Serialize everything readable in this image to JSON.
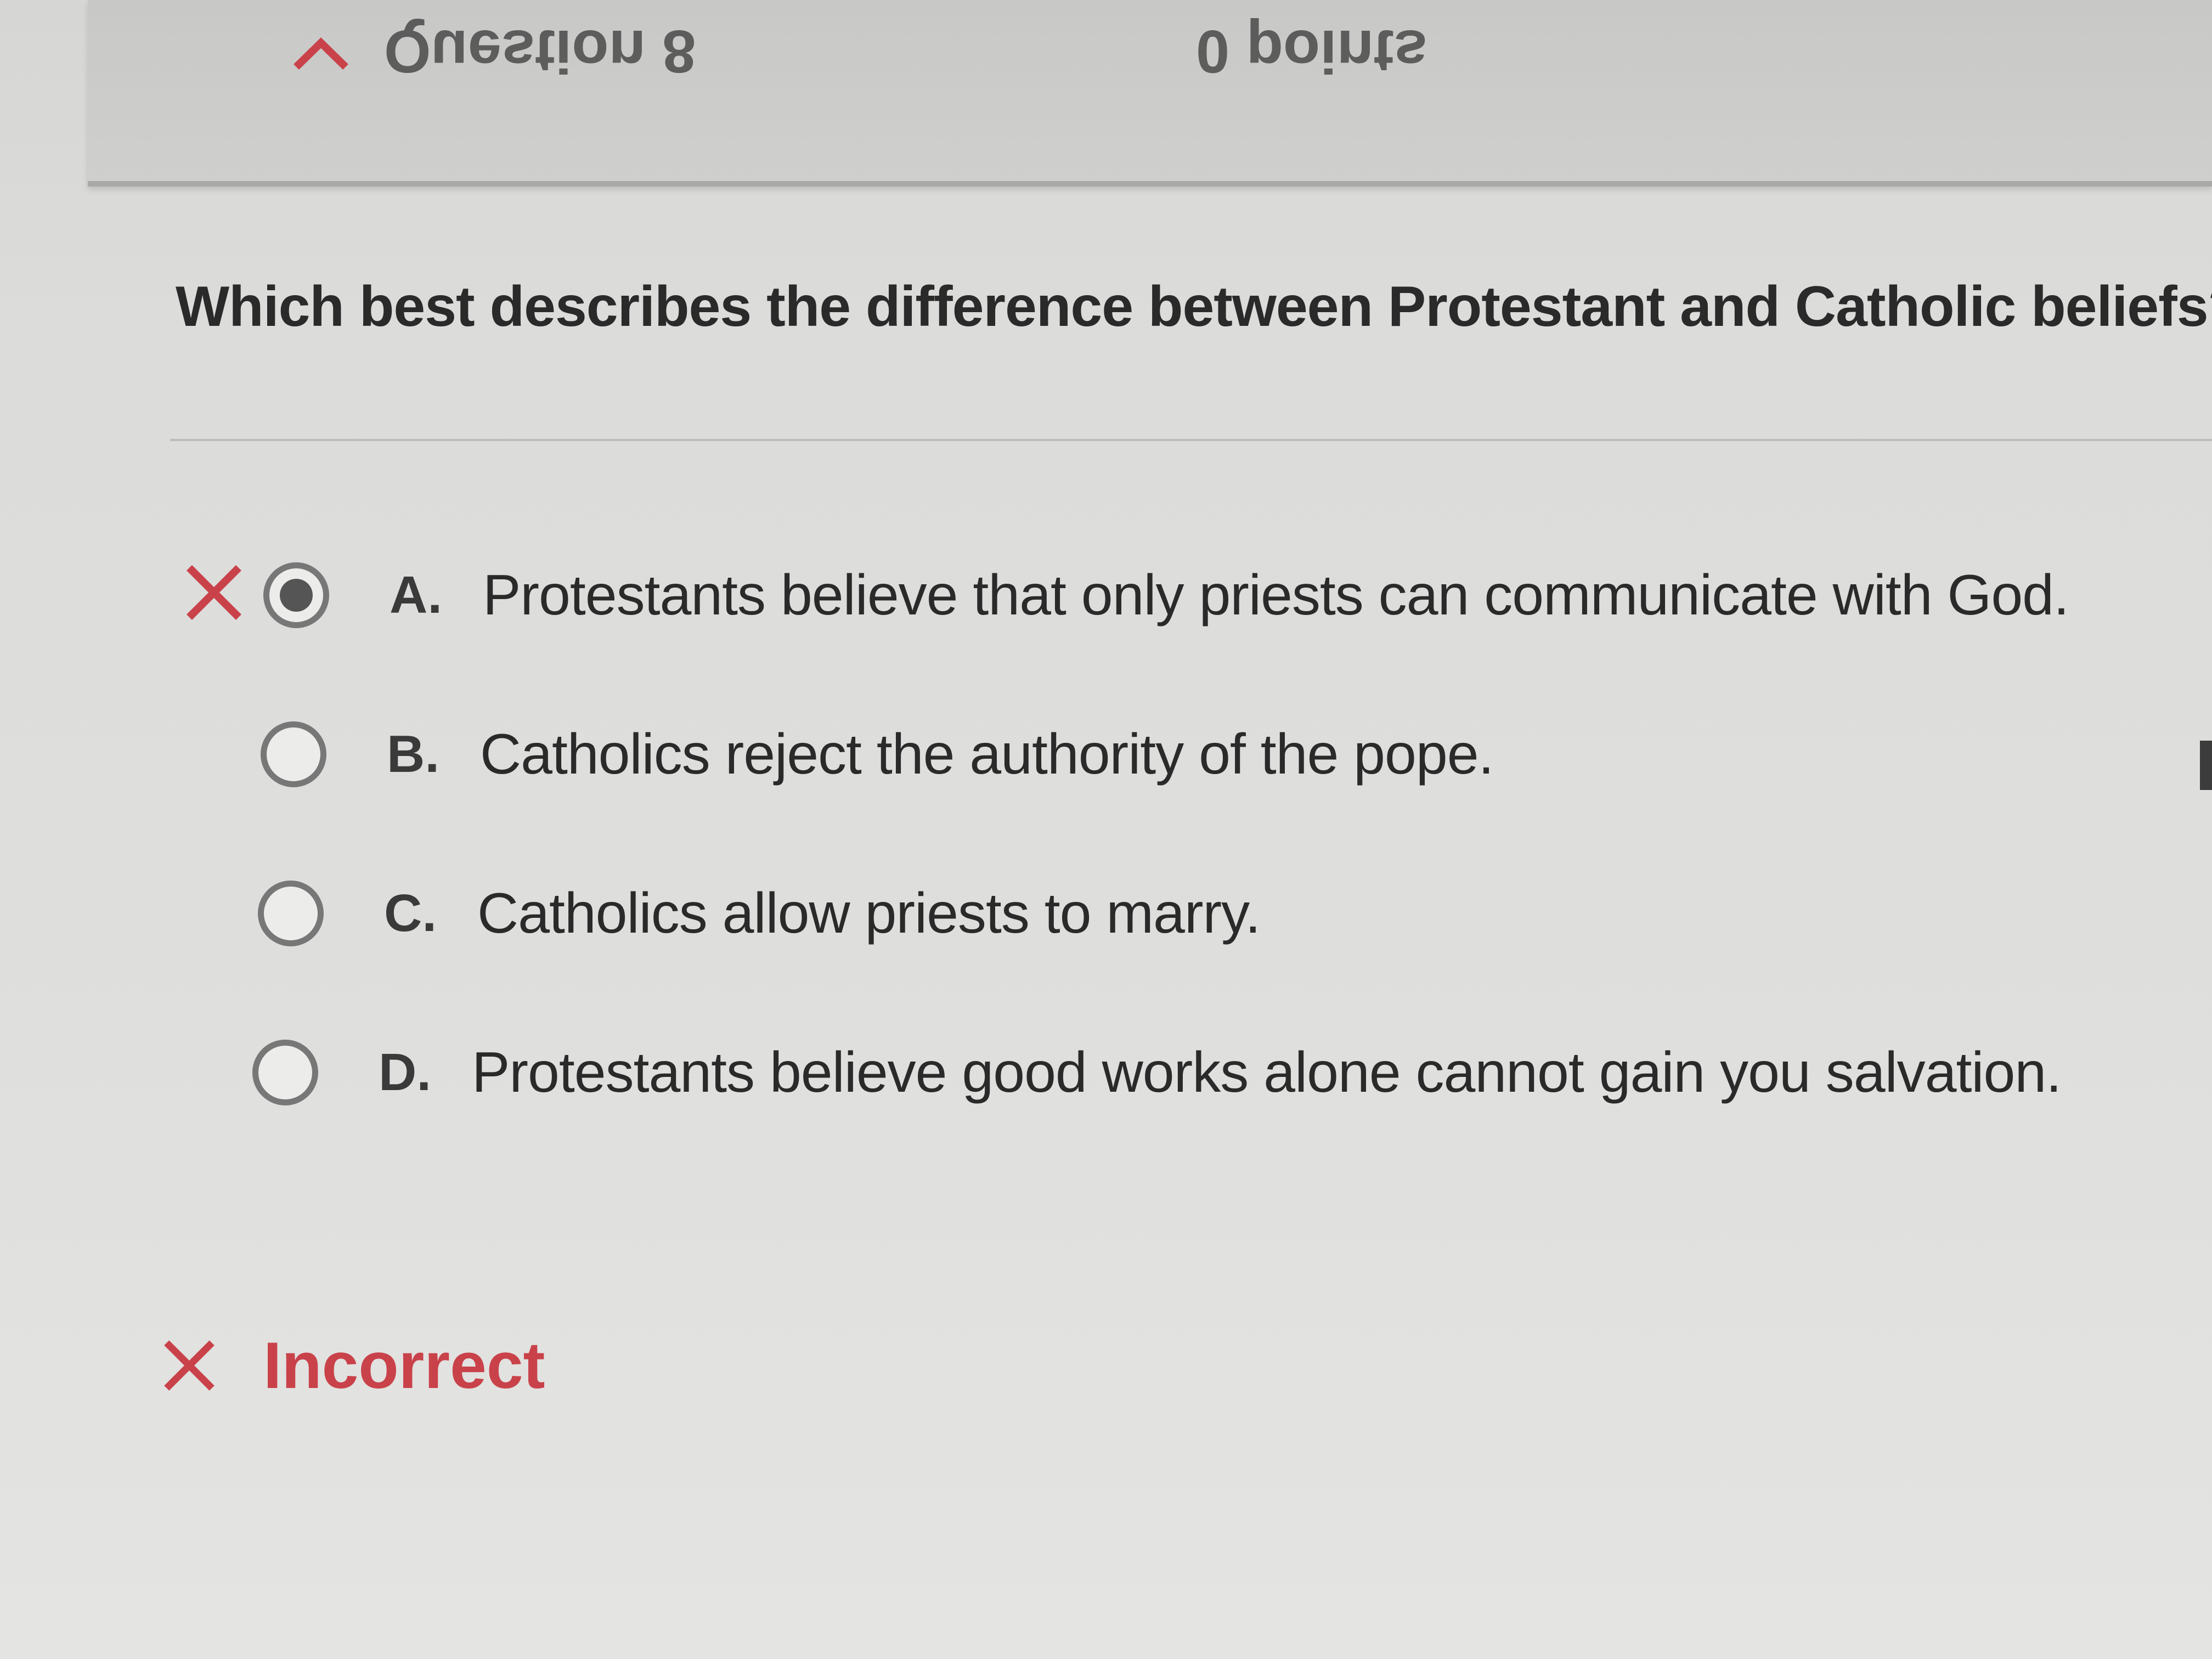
{
  "header": {
    "question_label": "Question 8",
    "points_label": "0 points"
  },
  "question": {
    "prompt": "Which best describes the difference between Protestant and Catholic beliefs?"
  },
  "options": [
    {
      "letter": "A.",
      "text": "Protestants believe that only priests can communicate with God.",
      "selected": true,
      "marked_wrong": true
    },
    {
      "letter": "B.",
      "text": "Catholics reject the authority of the pope.",
      "selected": false,
      "marked_wrong": false
    },
    {
      "letter": "C.",
      "text": "Catholics allow priests to marry.",
      "selected": false,
      "marked_wrong": false
    },
    {
      "letter": "D.",
      "text": "Protestants believe good works alone cannot gain you salvation.",
      "selected": false,
      "marked_wrong": false
    }
  ],
  "result": {
    "label": "Incorrect",
    "icon": "close-icon",
    "color": "#c9424a"
  },
  "colors": {
    "incorrect": "#c9424a",
    "radio_border": "#777777",
    "text": "#2a2a2a"
  }
}
